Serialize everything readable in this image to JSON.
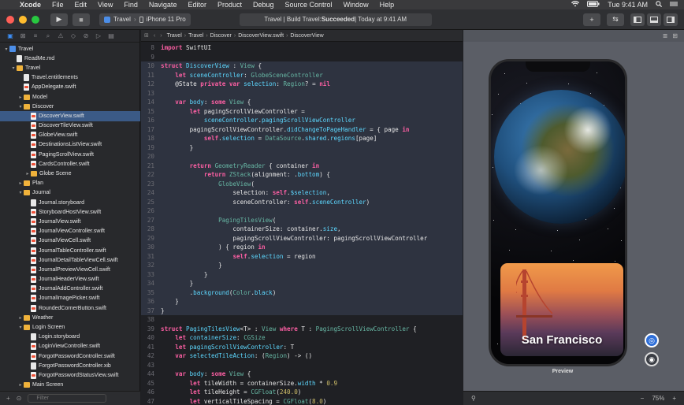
{
  "menubar": {
    "apple": "",
    "app": "Xcode",
    "menus": [
      "File",
      "Edit",
      "View",
      "Find",
      "Navigate",
      "Editor",
      "Product",
      "Debug",
      "Source Control",
      "Window",
      "Help"
    ],
    "time": "Tue 9:41 AM"
  },
  "toolbar": {
    "run_glyph": "▶",
    "stop_glyph": "■",
    "scheme": "Travel",
    "device": "iPhone 11 Pro",
    "status_prefix": "Travel | Build Travel: ",
    "status_result": "Succeeded",
    "status_time": " | Today at 9:41 AM",
    "add_glyph": "+",
    "back_glyph": "⇆"
  },
  "navigator": {
    "filter_placeholder": "Filter",
    "items": [
      {
        "label": "Travel",
        "depth": 0,
        "kind": "proj",
        "disc": "▾"
      },
      {
        "label": "ReadMe.md",
        "depth": 1,
        "kind": "doc",
        "disc": ""
      },
      {
        "label": "Travel",
        "depth": 1,
        "kind": "folder",
        "disc": "▾"
      },
      {
        "label": "Travel.entitlements",
        "depth": 2,
        "kind": "doc",
        "disc": ""
      },
      {
        "label": "AppDelegate.swift",
        "depth": 2,
        "kind": "swift",
        "disc": ""
      },
      {
        "label": "Model",
        "depth": 2,
        "kind": "folder",
        "disc": "▸"
      },
      {
        "label": "Discover",
        "depth": 2,
        "kind": "folder",
        "disc": "▾"
      },
      {
        "label": "DiscoverView.swift",
        "depth": 3,
        "kind": "swift",
        "disc": "",
        "selected": true
      },
      {
        "label": "DiscoverTileView.swift",
        "depth": 3,
        "kind": "swift",
        "disc": ""
      },
      {
        "label": "GlobeView.swift",
        "depth": 3,
        "kind": "swift",
        "disc": ""
      },
      {
        "label": "DestinationsListView.swift",
        "depth": 3,
        "kind": "swift",
        "disc": ""
      },
      {
        "label": "PagingScrollView.swift",
        "depth": 3,
        "kind": "swift",
        "disc": ""
      },
      {
        "label": "CardsController.swift",
        "depth": 3,
        "kind": "swift",
        "disc": ""
      },
      {
        "label": "Globe Scene",
        "depth": 3,
        "kind": "folder",
        "disc": "▸"
      },
      {
        "label": "Plan",
        "depth": 2,
        "kind": "folder",
        "disc": "▸"
      },
      {
        "label": "Journal",
        "depth": 2,
        "kind": "folder",
        "disc": "▾"
      },
      {
        "label": "Journal.storyboard",
        "depth": 3,
        "kind": "doc",
        "disc": ""
      },
      {
        "label": "StoryboardHostView.swift",
        "depth": 3,
        "kind": "swift",
        "disc": ""
      },
      {
        "label": "JournalView.swift",
        "depth": 3,
        "kind": "swift",
        "disc": ""
      },
      {
        "label": "JournalViewController.swift",
        "depth": 3,
        "kind": "swift",
        "disc": ""
      },
      {
        "label": "JournalViewCell.swift",
        "depth": 3,
        "kind": "swift",
        "disc": ""
      },
      {
        "label": "JournalTableController.swift",
        "depth": 3,
        "kind": "swift",
        "disc": ""
      },
      {
        "label": "JournalDetailTableViewCell.swift",
        "depth": 3,
        "kind": "swift",
        "disc": ""
      },
      {
        "label": "JournalPreviewViewCell.swift",
        "depth": 3,
        "kind": "swift",
        "disc": ""
      },
      {
        "label": "JournalHeaderView.swift",
        "depth": 3,
        "kind": "swift",
        "disc": ""
      },
      {
        "label": "JournalAddController.swift",
        "depth": 3,
        "kind": "swift",
        "disc": ""
      },
      {
        "label": "JournalImagePicker.swift",
        "depth": 3,
        "kind": "swift",
        "disc": ""
      },
      {
        "label": "RoundedCornerButton.swift",
        "depth": 3,
        "kind": "swift",
        "disc": ""
      },
      {
        "label": "Weather",
        "depth": 2,
        "kind": "folder",
        "disc": "▸"
      },
      {
        "label": "Login Screen",
        "depth": 2,
        "kind": "folder",
        "disc": "▾"
      },
      {
        "label": "Login.storyboard",
        "depth": 3,
        "kind": "doc",
        "disc": ""
      },
      {
        "label": "LoginViewController.swift",
        "depth": 3,
        "kind": "swift",
        "disc": ""
      },
      {
        "label": "ForgotPasswordController.swift",
        "depth": 3,
        "kind": "swift",
        "disc": ""
      },
      {
        "label": "ForgotPasswordController.xib",
        "depth": 3,
        "kind": "doc",
        "disc": ""
      },
      {
        "label": "ForgotPasswordStatusView.swift",
        "depth": 3,
        "kind": "swift",
        "disc": ""
      },
      {
        "label": "Main Screen",
        "depth": 2,
        "kind": "folder",
        "disc": "▸"
      }
    ]
  },
  "jumpbar": {
    "crumbs": [
      "Travel",
      "Travel",
      "Discover",
      "DiscoverView.swift",
      "DiscoverView"
    ]
  },
  "code": [
    {
      "n": "8",
      "t": [
        [
          "k",
          "import"
        ],
        [
          "d",
          " SwiftUI"
        ]
      ]
    },
    {
      "n": "9",
      "t": []
    },
    {
      "n": "10",
      "hl": true,
      "t": [
        [
          "k",
          "struct"
        ],
        [
          "d",
          " "
        ],
        [
          "t",
          "DiscoverView"
        ],
        [
          "d",
          " : "
        ],
        [
          "p",
          "View"
        ],
        [
          "d",
          " {"
        ]
      ]
    },
    {
      "n": "11",
      "hl": true,
      "t": [
        [
          "d",
          "    "
        ],
        [
          "k",
          "let"
        ],
        [
          "d",
          " "
        ],
        [
          "t",
          "sceneController"
        ],
        [
          "d",
          ": "
        ],
        [
          "p",
          "GlobeSceneController"
        ]
      ]
    },
    {
      "n": "12",
      "hl": true,
      "t": [
        [
          "d",
          "    @State "
        ],
        [
          "k",
          "private var"
        ],
        [
          "d",
          " "
        ],
        [
          "t",
          "selection"
        ],
        [
          "d",
          ": "
        ],
        [
          "p",
          "Region"
        ],
        [
          "d",
          "? = "
        ],
        [
          "k",
          "nil"
        ]
      ]
    },
    {
      "n": "13",
      "hl": true,
      "t": []
    },
    {
      "n": "14",
      "hl": true,
      "t": [
        [
          "d",
          "    "
        ],
        [
          "k",
          "var"
        ],
        [
          "d",
          " "
        ],
        [
          "t",
          "body"
        ],
        [
          "d",
          ": "
        ],
        [
          "k",
          "some"
        ],
        [
          "d",
          " "
        ],
        [
          "p",
          "View"
        ],
        [
          "d",
          " {"
        ]
      ]
    },
    {
      "n": "15",
      "hl": true,
      "t": [
        [
          "d",
          "        "
        ],
        [
          "k",
          "let"
        ],
        [
          "d",
          " pagingScrollViewController ="
        ]
      ]
    },
    {
      "n": "16",
      "hl": true,
      "t": [
        [
          "d",
          "            "
        ],
        [
          "t",
          "sceneController"
        ],
        [
          "d",
          "."
        ],
        [
          "t",
          "pagingScrollViewController"
        ]
      ]
    },
    {
      "n": "17",
      "hl": true,
      "t": [
        [
          "d",
          "        pagingScrollViewController."
        ],
        [
          "t",
          "didChangeToPageHandler"
        ],
        [
          "d",
          " = { page "
        ],
        [
          "k",
          "in"
        ]
      ]
    },
    {
      "n": "18",
      "hl": true,
      "t": [
        [
          "d",
          "            "
        ],
        [
          "k",
          "self"
        ],
        [
          "d",
          "."
        ],
        [
          "t",
          "selection"
        ],
        [
          "d",
          " = "
        ],
        [
          "p",
          "DataSource"
        ],
        [
          "d",
          "."
        ],
        [
          "t",
          "shared"
        ],
        [
          "d",
          "."
        ],
        [
          "t",
          "regions"
        ],
        [
          "d",
          "[page]"
        ]
      ]
    },
    {
      "n": "19",
      "hl": true,
      "t": [
        [
          "d",
          "        }"
        ]
      ]
    },
    {
      "n": "20",
      "hl": true,
      "t": []
    },
    {
      "n": "21",
      "hl": true,
      "t": [
        [
          "d",
          "        "
        ],
        [
          "k",
          "return"
        ],
        [
          "d",
          " "
        ],
        [
          "p",
          "GeometryReader"
        ],
        [
          "d",
          " { container "
        ],
        [
          "k",
          "in"
        ]
      ]
    },
    {
      "n": "22",
      "hl": true,
      "t": [
        [
          "d",
          "            "
        ],
        [
          "k",
          "return"
        ],
        [
          "d",
          " "
        ],
        [
          "p",
          "ZStack"
        ],
        [
          "d",
          "(alignment: ."
        ],
        [
          "t",
          "bottom"
        ],
        [
          "d",
          ") {"
        ]
      ]
    },
    {
      "n": "23",
      "hl": true,
      "t": [
        [
          "d",
          "                "
        ],
        [
          "p",
          "GlobeView"
        ],
        [
          "d",
          "("
        ]
      ]
    },
    {
      "n": "24",
      "hl": true,
      "t": [
        [
          "d",
          "                    selection: "
        ],
        [
          "k",
          "self"
        ],
        [
          "d",
          "."
        ],
        [
          "t",
          "$selection"
        ],
        [
          "d",
          ","
        ]
      ]
    },
    {
      "n": "25",
      "hl": true,
      "t": [
        [
          "d",
          "                    sceneController: "
        ],
        [
          "k",
          "self"
        ],
        [
          "d",
          "."
        ],
        [
          "t",
          "sceneController"
        ],
        [
          "d",
          ")"
        ]
      ]
    },
    {
      "n": "26",
      "hl": true,
      "t": []
    },
    {
      "n": "27",
      "hl": true,
      "t": [
        [
          "d",
          "                "
        ],
        [
          "p",
          "PagingTilesView"
        ],
        [
          "d",
          "("
        ]
      ]
    },
    {
      "n": "28",
      "hl": true,
      "t": [
        [
          "d",
          "                    containerSize: container."
        ],
        [
          "t",
          "size"
        ],
        [
          "d",
          ","
        ]
      ]
    },
    {
      "n": "29",
      "hl": true,
      "t": [
        [
          "d",
          "                    pagingScrollViewController: pagingScrollViewController"
        ]
      ]
    },
    {
      "n": "30",
      "hl": true,
      "t": [
        [
          "d",
          "                ) { region "
        ],
        [
          "k",
          "in"
        ]
      ]
    },
    {
      "n": "31",
      "hl": true,
      "t": [
        [
          "d",
          "                    "
        ],
        [
          "k",
          "self"
        ],
        [
          "d",
          "."
        ],
        [
          "t",
          "selection"
        ],
        [
          "d",
          " = region"
        ]
      ]
    },
    {
      "n": "32",
      "hl": true,
      "t": [
        [
          "d",
          "                }"
        ]
      ]
    },
    {
      "n": "33",
      "hl": true,
      "t": [
        [
          "d",
          "            }"
        ]
      ]
    },
    {
      "n": "34",
      "hl": true,
      "t": [
        [
          "d",
          "        }"
        ]
      ]
    },
    {
      "n": "35",
      "hl": true,
      "t": [
        [
          "d",
          "        ."
        ],
        [
          "t",
          "background"
        ],
        [
          "d",
          "("
        ],
        [
          "p",
          "Color"
        ],
        [
          "d",
          "."
        ],
        [
          "t",
          "black"
        ],
        [
          "d",
          ")"
        ]
      ]
    },
    {
      "n": "36",
      "hl": true,
      "t": [
        [
          "d",
          "    }"
        ]
      ]
    },
    {
      "n": "37",
      "hl": true,
      "t": [
        [
          "d",
          "}"
        ]
      ]
    },
    {
      "n": "38",
      "t": []
    },
    {
      "n": "39",
      "t": [
        [
          "k",
          "struct"
        ],
        [
          "d",
          " "
        ],
        [
          "t",
          "PagingTilesView"
        ],
        [
          "d",
          "<T> : "
        ],
        [
          "p",
          "View"
        ],
        [
          "d",
          " "
        ],
        [
          "k",
          "where"
        ],
        [
          "d",
          " T : "
        ],
        [
          "p",
          "PagingScrollViewController"
        ],
        [
          "d",
          " {"
        ]
      ]
    },
    {
      "n": "40",
      "t": [
        [
          "d",
          "    "
        ],
        [
          "k",
          "let"
        ],
        [
          "d",
          " "
        ],
        [
          "t",
          "containerSize"
        ],
        [
          "d",
          ": "
        ],
        [
          "p",
          "CGSize"
        ]
      ]
    },
    {
      "n": "41",
      "t": [
        [
          "d",
          "    "
        ],
        [
          "k",
          "let"
        ],
        [
          "d",
          " "
        ],
        [
          "t",
          "pagingScrollViewController"
        ],
        [
          "d",
          ": T"
        ]
      ]
    },
    {
      "n": "42",
      "t": [
        [
          "d",
          "    "
        ],
        [
          "k",
          "var"
        ],
        [
          "d",
          " "
        ],
        [
          "t",
          "selectedTileAction"
        ],
        [
          "d",
          ": ("
        ],
        [
          "p",
          "Region"
        ],
        [
          "d",
          ") -> ()"
        ]
      ]
    },
    {
      "n": "43",
      "t": []
    },
    {
      "n": "44",
      "t": [
        [
          "d",
          "    "
        ],
        [
          "k",
          "var"
        ],
        [
          "d",
          " "
        ],
        [
          "t",
          "body"
        ],
        [
          "d",
          ": "
        ],
        [
          "k",
          "some"
        ],
        [
          "d",
          " "
        ],
        [
          "p",
          "View"
        ],
        [
          "d",
          " {"
        ]
      ]
    },
    {
      "n": "45",
      "t": [
        [
          "d",
          "        "
        ],
        [
          "k",
          "let"
        ],
        [
          "d",
          " tileWidth = containerSize."
        ],
        [
          "t",
          "width"
        ],
        [
          "d",
          " * "
        ],
        [
          "n",
          "0.9"
        ]
      ]
    },
    {
      "n": "46",
      "t": [
        [
          "d",
          "        "
        ],
        [
          "k",
          "let"
        ],
        [
          "d",
          " tileHeight = "
        ],
        [
          "p",
          "CGFloat"
        ],
        [
          "d",
          "("
        ],
        [
          "n",
          "240.0"
        ],
        [
          "d",
          ")"
        ]
      ]
    },
    {
      "n": "47",
      "t": [
        [
          "d",
          "        "
        ],
        [
          "k",
          "let"
        ],
        [
          "d",
          " verticalTileSpacing = "
        ],
        [
          "p",
          "CGFloat"
        ],
        [
          "d",
          "("
        ],
        [
          "n",
          "8.0"
        ],
        [
          "d",
          ")"
        ]
      ]
    }
  ],
  "preview": {
    "card_title": "San Francisco",
    "label": "Preview",
    "zoom": "75%"
  },
  "colors": {
    "accent": "#3d8ef5",
    "close": "#fe5f57",
    "minimize": "#febc2e",
    "zoom": "#28c840"
  }
}
